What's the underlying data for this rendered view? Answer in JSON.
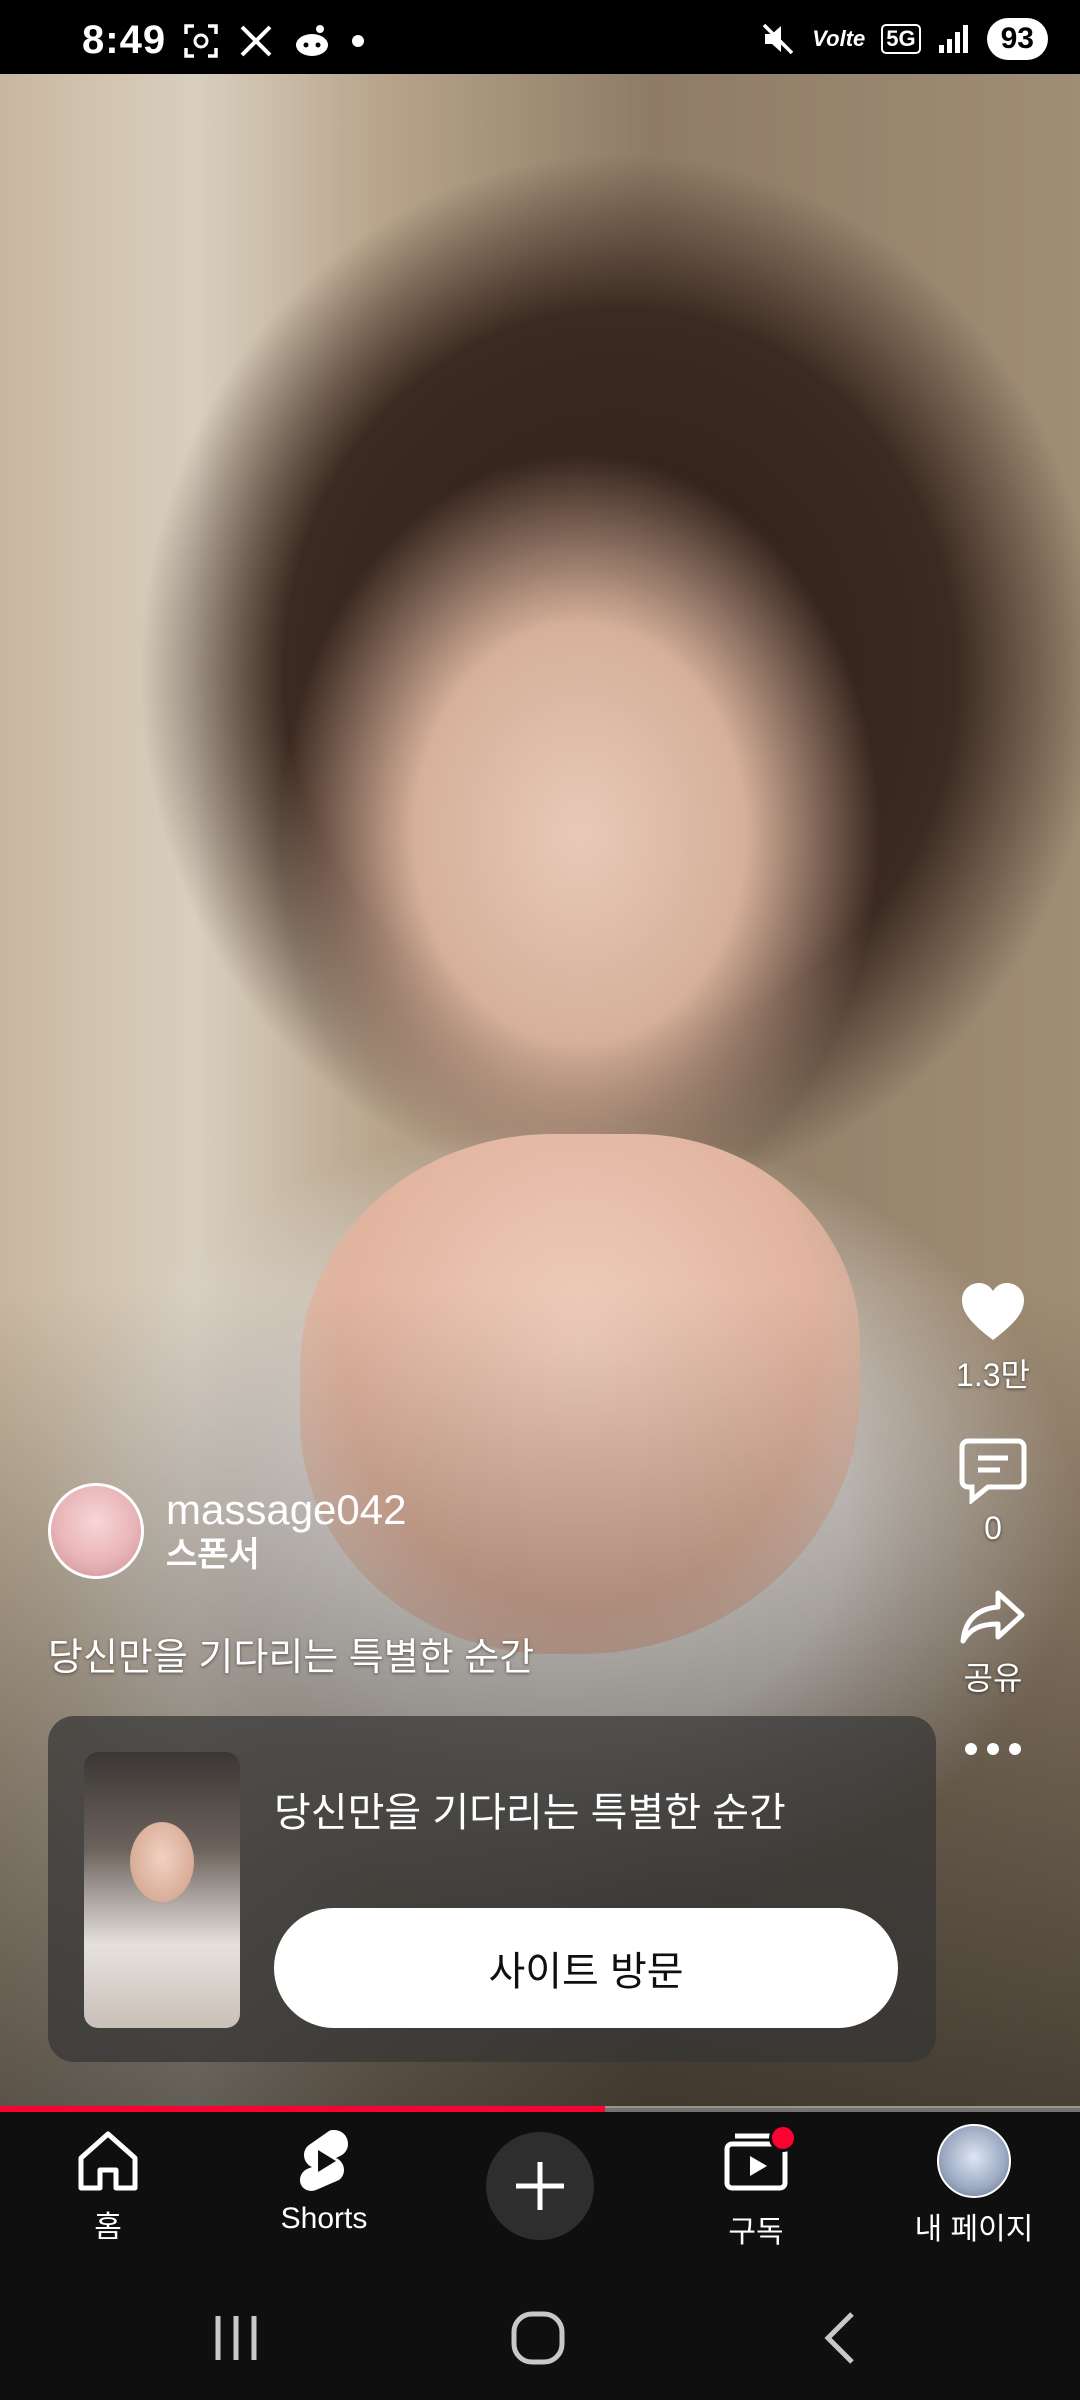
{
  "status_bar": {
    "time": "8:49",
    "battery": "93",
    "left_icons": [
      "screen-capture-icon",
      "x-logo-icon",
      "reddit-icon",
      "dot-icon"
    ],
    "right_icons": [
      "mute-icon",
      "volte-icon",
      "5g-icon",
      "signal-icon"
    ],
    "volte_text": "Volte",
    "network_text": "5G"
  },
  "actions": {
    "like_count": "1.3만",
    "comment_count": "0",
    "share_label": "공유"
  },
  "channel": {
    "name": "massage042",
    "sponsor_label": "스폰서"
  },
  "video": {
    "title": "당신만을 기다리는 특별한 순간",
    "progress": 0.56
  },
  "ad_card": {
    "headline": "당신만을 기다리는 특별한 순간",
    "cta_label": "사이트 방문"
  },
  "nav": {
    "home": "홈",
    "shorts": "Shorts",
    "subscriptions": "구독",
    "my_page": "내 페이지"
  },
  "colors": {
    "accent": "#ff0033",
    "nav_background": "#0f0f0f"
  }
}
